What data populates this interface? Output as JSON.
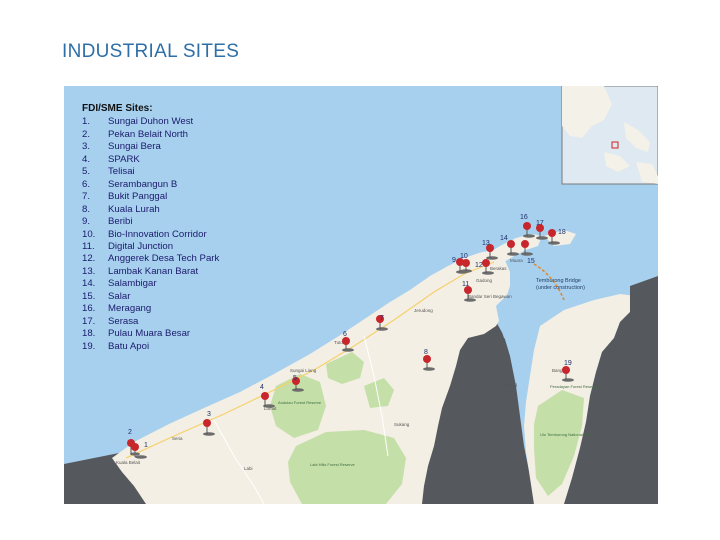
{
  "slide": {
    "title": "INDUSTRIAL SITES"
  },
  "legend": {
    "title": "FDI/SME Sites:",
    "items": [
      {
        "num": "1.",
        "name": "Sungai Duhon West"
      },
      {
        "num": "2.",
        "name": "Pekan Belait North"
      },
      {
        "num": "3.",
        "name": "Sungai Bera"
      },
      {
        "num": "4.",
        "name": "SPARK"
      },
      {
        "num": "5.",
        "name": "Telisai"
      },
      {
        "num": "6.",
        "name": "Serambangun B"
      },
      {
        "num": "7.",
        "name": "Bukit Panggal"
      },
      {
        "num": "8.",
        "name": "Kuala Lurah"
      },
      {
        "num": "9.",
        "name": "Beribi"
      },
      {
        "num": "10.",
        "name": "Bio-Innovation Corridor"
      },
      {
        "num": "11.",
        "name": "Digital Junction"
      },
      {
        "num": "12.",
        "name": "Anggerek Desa Tech Park"
      },
      {
        "num": "13.",
        "name": "Lambak Kanan Barat"
      },
      {
        "num": "14.",
        "name": "Salambigar"
      },
      {
        "num": "15.",
        "name": "Salar"
      },
      {
        "num": "16.",
        "name": "Meragang"
      },
      {
        "num": "17.",
        "name": "Serasa"
      },
      {
        "num": "18.",
        "name": "Pulau Muara Besar"
      },
      {
        "num": "19.",
        "name": "Batu Apoi"
      }
    ]
  },
  "map": {
    "colors": {
      "sea": "#a7d0ef",
      "land": "#f3efe4",
      "forest": "#c4dfa8",
      "neighbor": "#55595d",
      "pin": "#c8262d",
      "water_inland": "#a7d0ef"
    },
    "pins": [
      {
        "label": "1"
      },
      {
        "label": "2"
      },
      {
        "label": "3"
      },
      {
        "label": "4"
      },
      {
        "label": "5"
      },
      {
        "label": "6"
      },
      {
        "label": "7"
      },
      {
        "label": "8"
      },
      {
        "label": "9"
      },
      {
        "label": "10"
      },
      {
        "label": "11"
      },
      {
        "label": "12"
      },
      {
        "label": "13"
      },
      {
        "label": "14"
      },
      {
        "label": "15"
      },
      {
        "label": "16"
      },
      {
        "label": "17"
      },
      {
        "label": "18"
      },
      {
        "label": "19"
      }
    ],
    "annotation": {
      "line1": "Temburong Bridge",
      "line2": "(under construction)"
    },
    "places": {
      "kuala_belait": "Kuala Belait",
      "seria": "Seria",
      "bandar": "Bandar Seri Begawan",
      "muara": "Muara",
      "bangar": "Bangar",
      "tutong": "Tutong",
      "labi": "Labi",
      "lumut": "Lumut",
      "sukang": "Sukang",
      "ulu_temburong": "Ulu Temburong National Park",
      "peradayan": "Peradayan Forest Reserve",
      "labi_forest": "Labi Hills Forest Reserve",
      "andulau": "Andulau Forest Reserve",
      "sungai_liang": "Sungai Liang",
      "jerudong": "Jerudong",
      "gadong": "Gadong",
      "berakas": "Berakas",
      "limbang": "Limbang"
    },
    "inset": {
      "name": "locator-map"
    }
  }
}
